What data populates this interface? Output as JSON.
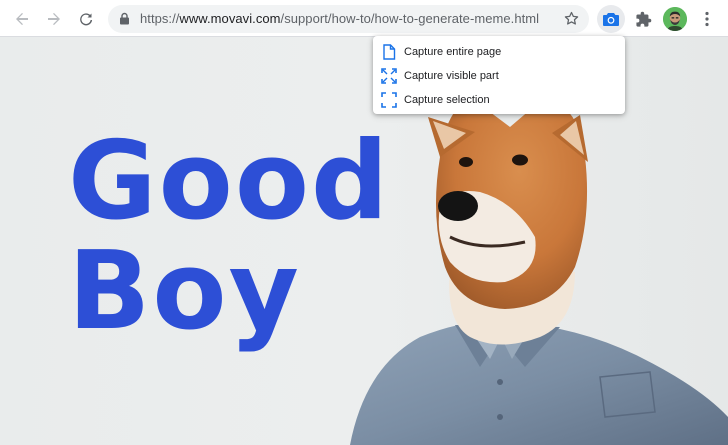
{
  "browser": {
    "url_prefix": "https://",
    "url_host": "www.movavi.com",
    "url_path": "/support/how-to/how-to-generate-meme.html",
    "icons": {
      "back": "arrow-left-icon",
      "forward": "arrow-right-icon",
      "reload": "reload-icon",
      "lock": "lock-icon",
      "bookmark": "star-icon",
      "extension_active": "camera-icon",
      "extensions": "puzzle-icon",
      "menu": "more-vert-icon"
    }
  },
  "popup": {
    "items": [
      {
        "label": "Capture entire page",
        "icon": "page-icon"
      },
      {
        "label": "Capture visible part",
        "icon": "expand-corners-icon"
      },
      {
        "label": "Capture selection",
        "icon": "selection-corners-icon"
      }
    ]
  },
  "meme": {
    "line1": "Good",
    "line2": "Boy",
    "color": "#2d4fd6"
  },
  "colors": {
    "accent": "#1a73e8",
    "icon_gray": "#5f6368"
  }
}
